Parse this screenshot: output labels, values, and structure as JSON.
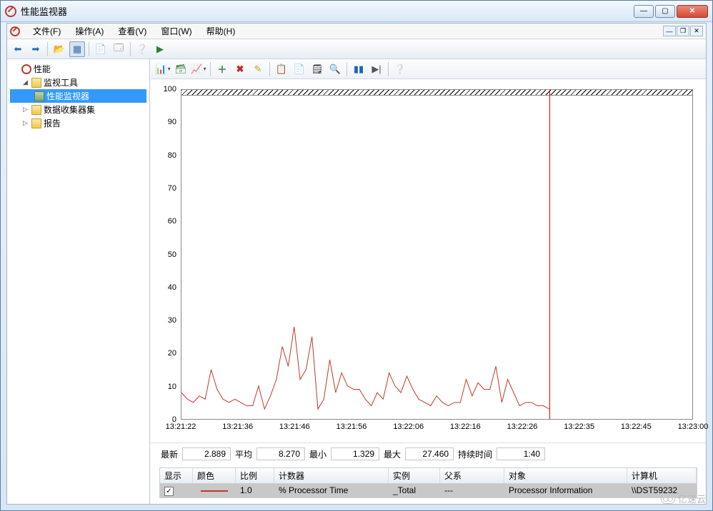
{
  "window": {
    "title": "性能监视器"
  },
  "menu": {
    "file": "文件(F)",
    "action": "操作(A)",
    "view": "查看(V)",
    "window": "窗口(W)",
    "help": "帮助(H)"
  },
  "tree": {
    "root": "性能",
    "monitor_tools": "监视工具",
    "perf_monitor": "性能监视器",
    "data_collector_sets": "数据收集器集",
    "reports": "报告"
  },
  "stats": {
    "latest_label": "最新",
    "latest_value": "2.889",
    "avg_label": "平均",
    "avg_value": "8.270",
    "min_label": "最小",
    "min_value": "1.329",
    "max_label": "最大",
    "max_value": "27.460",
    "duration_label": "持续时间",
    "duration_value": "1:40"
  },
  "columns": {
    "show": "显示",
    "color": "颜色",
    "scale": "比例",
    "counter": "计数器",
    "instance": "实例",
    "parent": "父系",
    "object": "对象",
    "computer": "计算机"
  },
  "row": {
    "checked": "✓",
    "scale": "1.0",
    "counter": "% Processor Time",
    "instance": "_Total",
    "parent": "---",
    "object": "Processor Information",
    "computer": "\\\\DST59232"
  },
  "chart_data": {
    "type": "line",
    "ylim": [
      0,
      100
    ],
    "yticks": [
      0,
      10,
      20,
      30,
      40,
      50,
      60,
      70,
      80,
      90,
      100
    ],
    "xticks": [
      "13:21:22",
      "13:21:36",
      "13:21:46",
      "13:21:56",
      "13:22:06",
      "13:22:16",
      "13:22:26",
      "13:22:35",
      "13:22:45",
      "13:23:00"
    ],
    "cursor_x_fraction": 0.72,
    "series": [
      {
        "name": "% Processor Time",
        "color": "#c0392b",
        "values": [
          8,
          6,
          5,
          7,
          6,
          15,
          9,
          6,
          5,
          6,
          5,
          4,
          4,
          10,
          3,
          7,
          12,
          22,
          16,
          28,
          12,
          15,
          25,
          3,
          6,
          18,
          8,
          14,
          10,
          9,
          9,
          6,
          4,
          8,
          6,
          14,
          10,
          8,
          13,
          9,
          6,
          5,
          4,
          7,
          5,
          4,
          5,
          5,
          12,
          7,
          11,
          9,
          9,
          16,
          5,
          12,
          8,
          4,
          5,
          5,
          4,
          4,
          3
        ]
      }
    ]
  },
  "watermark": "亿速云"
}
